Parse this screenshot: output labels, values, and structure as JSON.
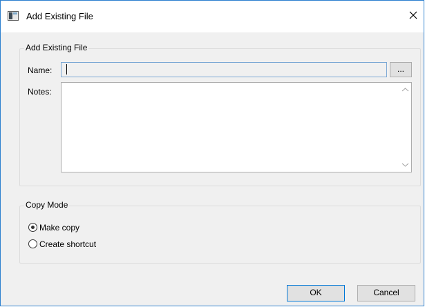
{
  "window": {
    "title": "Add Existing File"
  },
  "file_group": {
    "legend": "Add Existing File",
    "name_label": "Name:",
    "name_value": "",
    "browse_label": "...",
    "notes_label": "Notes:",
    "notes_value": ""
  },
  "copy_mode": {
    "legend": "Copy Mode",
    "options": [
      {
        "label": "Make copy",
        "selected": true
      },
      {
        "label": "Create shortcut",
        "selected": false
      }
    ]
  },
  "buttons": {
    "ok_label": "OK",
    "cancel_label": "Cancel"
  },
  "icons": {
    "app": "window-icon",
    "close": "close-icon",
    "scroll_up": "scroll-up-arrow-icon",
    "scroll_down": "scroll-down-arrow-icon"
  },
  "colors": {
    "window_border": "#2b7fcf",
    "focus_border": "#7aa7d4",
    "default_button_border": "#0078d7"
  }
}
